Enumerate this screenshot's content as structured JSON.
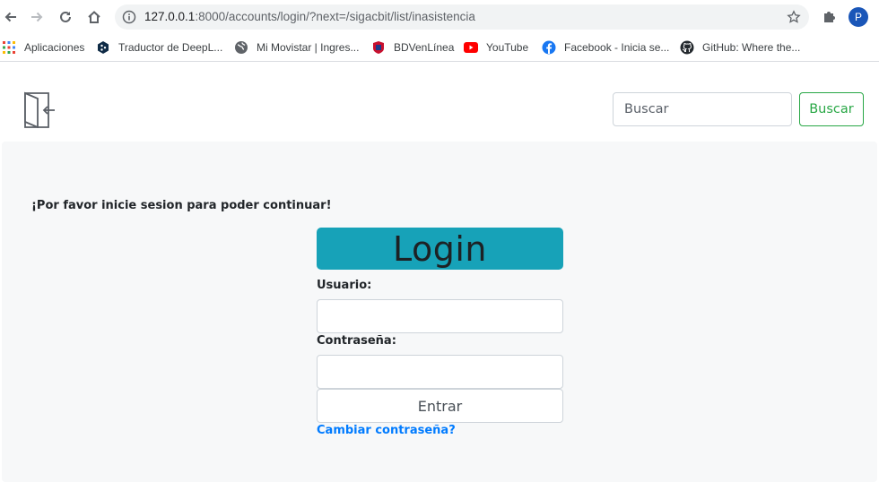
{
  "browser": {
    "url_host": "127.0.0.1",
    "url_rest": ":8000/accounts/login/?next=/sigacbit/list/inasistencia",
    "profile_initial": "P"
  },
  "bookmarks": [
    {
      "label": "Aplicaciones",
      "icon": "apps-grid-icon"
    },
    {
      "label": "Traductor de DeepL...",
      "icon": "deepl-icon"
    },
    {
      "label": "Mi Movistar | Ingres...",
      "icon": "globe-icon"
    },
    {
      "label": "BDVenLínea",
      "icon": "bdv-icon"
    },
    {
      "label": "YouTube",
      "icon": "youtube-icon"
    },
    {
      "label": "Facebook - Inicia se...",
      "icon": "facebook-icon"
    },
    {
      "label": "GitHub: Where the...",
      "icon": "github-icon"
    }
  ],
  "header": {
    "search_placeholder": "Buscar",
    "search_button": "Buscar"
  },
  "main": {
    "notice": "¡Por favor inicie sesion para poder continuar!",
    "login_title": "Login",
    "username_label": "Usuario:",
    "password_label": "Contraseña:",
    "submit_label": "Entrar",
    "change_password_link": "Cambiar contraseña?"
  },
  "colors": {
    "accent": "#17a2b8",
    "success": "#28a745",
    "link": "#007bff",
    "background": "#f7f8f9"
  }
}
